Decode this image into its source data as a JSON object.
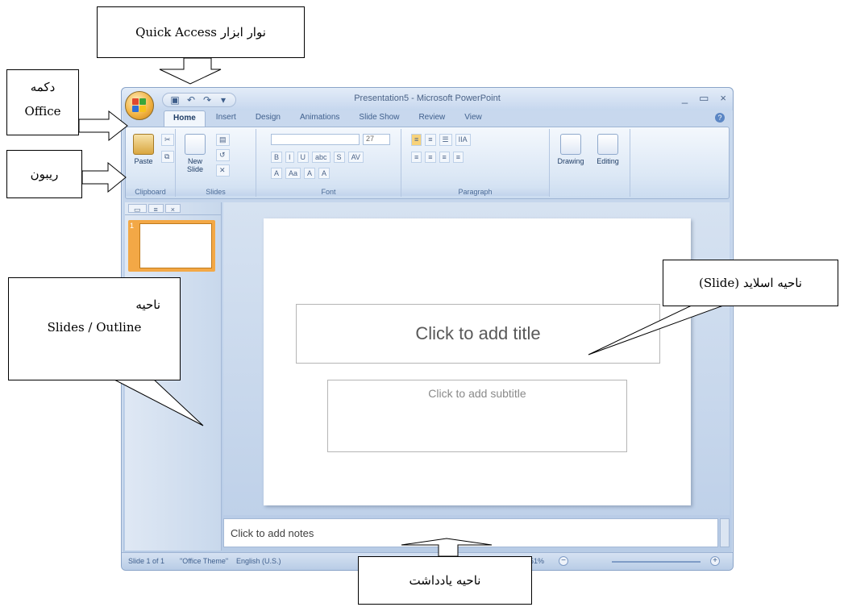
{
  "window": {
    "title": "Presentation5 - Microsoft PowerPoint",
    "controls": [
      "_",
      "▭",
      "×"
    ],
    "qat_icons": [
      "save-icon",
      "undo-icon",
      "redo-icon",
      "customize-icon"
    ],
    "qat_glyphs": [
      "▣",
      "↶",
      "↷",
      "▾"
    ]
  },
  "tabs": [
    "Home",
    "Insert",
    "Design",
    "Animations",
    "Slide Show",
    "Review",
    "View"
  ],
  "ribbon": {
    "clipboard": {
      "label": "Clipboard",
      "paste": "Paste"
    },
    "slides": {
      "label": "Slides",
      "new_slide": "New Slide"
    },
    "font": {
      "label": "Font",
      "size": "27",
      "row1": [
        "B",
        "I",
        "U",
        "abc",
        "S",
        "AV"
      ],
      "row2": [
        "A",
        "Aa",
        "A",
        "A"
      ]
    },
    "paragraph": {
      "label": "Paragraph",
      "row1": [
        "≡",
        "≡",
        "☰",
        "IIA"
      ],
      "row2": [
        "≡",
        "≡",
        "≡",
        "≡"
      ]
    },
    "drawing": "Drawing",
    "editing": "Editing"
  },
  "slides_pane": {
    "thumb_number": "1"
  },
  "slide": {
    "title_placeholder": "Click to add title",
    "subtitle_placeholder": "Click to add subtitle"
  },
  "notes_placeholder": "Click to add notes",
  "status": {
    "slide": "Slide 1 of 1",
    "theme": "\"Office Theme\"",
    "language": "English (U.S.)",
    "zoom": "51%"
  },
  "callouts": {
    "quick_access": "نوار ابزار Quick Access",
    "office_button_line1": "دکمه",
    "office_button_line2": "Office",
    "ribbon": "ریبون",
    "slides_outline_line1": "ناحیه",
    "slides_outline_line2": "Slides / Outline",
    "slide_area": "ناحیه اسلاید (Slide)",
    "notes_area": "ناحیه یادداشت"
  }
}
